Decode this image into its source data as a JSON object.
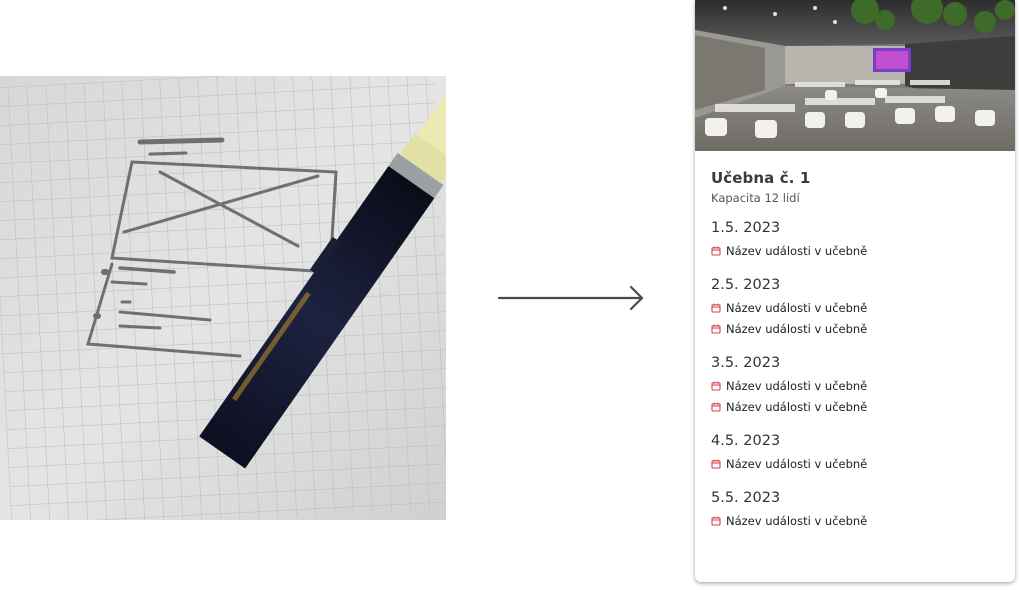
{
  "illustration": {
    "sketch_icon": "pencil-wireframe-sketch"
  },
  "arrow_icon": "right-arrow",
  "card": {
    "image_icon": "classroom-photo",
    "room_title": "Učebna č. 1",
    "capacity": "Kapacita 12 lidí",
    "accent_color": "#d9434e",
    "days": [
      {
        "date": "1.5. 2023",
        "events": [
          "Název události v učebně"
        ]
      },
      {
        "date": "2.5. 2023",
        "events": [
          "Název události v učebně",
          "Název události v učebně"
        ]
      },
      {
        "date": "3.5. 2023",
        "events": [
          "Název události v učebně",
          "Název události v učebně"
        ]
      },
      {
        "date": "4.5. 2023",
        "events": [
          "Název události v učebně"
        ]
      },
      {
        "date": "5.5. 2023",
        "events": [
          "Název události v učebně"
        ]
      }
    ]
  }
}
